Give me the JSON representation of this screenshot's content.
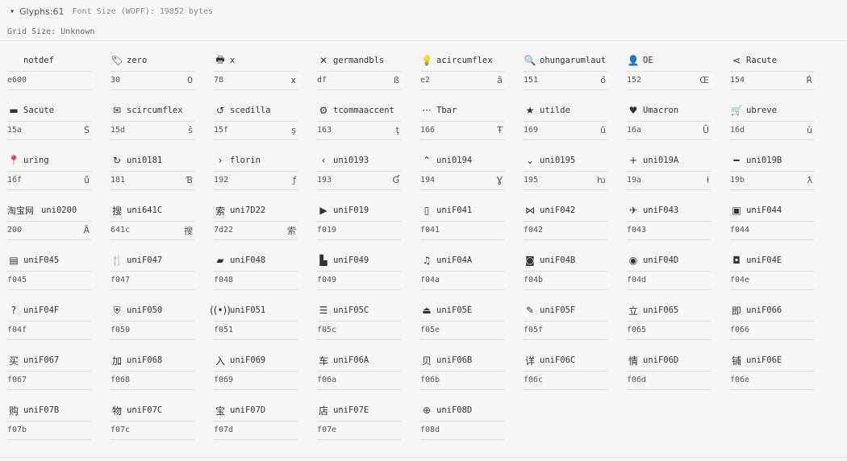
{
  "header": {
    "toggle_icon": "▾",
    "glyphs_label": "Glyphs:",
    "glyphs_count": "61",
    "font_size": "Font Size (WOFF): 19852 bytes",
    "grid_size": "Grid Size: Unknown"
  },
  "glyphs": [
    {
      "icon": "",
      "name": "notdef",
      "code": "e600",
      "glyph": "",
      "icon_name": "notdef-icon"
    },
    {
      "icon": "🏷",
      "name": "zero",
      "code": "30",
      "glyph": "0",
      "icon_name": "tag-icon"
    },
    {
      "icon": "🖶",
      "name": "x",
      "code": "78",
      "glyph": "x",
      "icon_name": "print-icon"
    },
    {
      "icon": "✕",
      "name": "germandbls",
      "code": "df",
      "glyph": "ß",
      "icon_name": "close-icon"
    },
    {
      "icon": "💡",
      "name": "acircumflex",
      "code": "e2",
      "glyph": "â",
      "icon_name": "lightbulb-icon"
    },
    {
      "icon": "🔍",
      "name": "ohungarumlaut",
      "code": "151",
      "glyph": "ő",
      "icon_name": "search-icon"
    },
    {
      "icon": "👤",
      "name": "OE",
      "code": "152",
      "glyph": "Œ",
      "icon_name": "user-icon"
    },
    {
      "icon": "⋖",
      "name": "Racute",
      "code": "154",
      "glyph": "Ŕ",
      "icon_name": "share-icon"
    },
    {
      "icon": "▬",
      "name": "Sacute",
      "code": "15a",
      "glyph": "Ś",
      "icon_name": "credit-card-icon"
    },
    {
      "icon": "✉",
      "name": "scircumflex",
      "code": "15d",
      "glyph": "ŝ",
      "icon_name": "mail-icon"
    },
    {
      "icon": "↺",
      "name": "scedilla",
      "code": "15f",
      "glyph": "ş",
      "icon_name": "undo-icon"
    },
    {
      "icon": "⚙",
      "name": "tcommaaccent",
      "code": "163",
      "glyph": "ţ",
      "icon_name": "gear-icon"
    },
    {
      "icon": "···",
      "name": "Tbar",
      "code": "166",
      "glyph": "Ŧ",
      "icon_name": "more-icon"
    },
    {
      "icon": "★",
      "name": "utilde",
      "code": "169",
      "glyph": "ũ",
      "icon_name": "star-icon"
    },
    {
      "icon": "♥",
      "name": "Umacron",
      "code": "16a",
      "glyph": "Ū",
      "icon_name": "heart-icon"
    },
    {
      "icon": "🛒",
      "name": "ubreve",
      "code": "16d",
      "glyph": "ŭ",
      "icon_name": "cart-icon"
    },
    {
      "icon": "📍",
      "name": "uring",
      "code": "16f",
      "glyph": "ů",
      "icon_name": "location-pin-icon"
    },
    {
      "icon": "↻",
      "name": "uni0181",
      "code": "181",
      "glyph": "Ɓ",
      "icon_name": "refresh-icon"
    },
    {
      "icon": "›",
      "name": "florin",
      "code": "192",
      "glyph": "ƒ",
      "icon_name": "chevron-right-icon"
    },
    {
      "icon": "‹",
      "name": "uni0193",
      "code": "193",
      "glyph": "Ɠ",
      "icon_name": "chevron-left-icon"
    },
    {
      "icon": "⌃",
      "name": "uni0194",
      "code": "194",
      "glyph": "Ɣ",
      "icon_name": "chevron-up-icon"
    },
    {
      "icon": "⌄",
      "name": "uni0195",
      "code": "195",
      "glyph": "ƕ",
      "icon_name": "chevron-down-icon"
    },
    {
      "icon": "+",
      "name": "uni019A",
      "code": "19a",
      "glyph": "ƚ",
      "icon_name": "plus-icon"
    },
    {
      "icon": "━",
      "name": "uni019B",
      "code": "19b",
      "glyph": "ƛ",
      "icon_name": "minus-icon"
    },
    {
      "icon": "淘宝网",
      "name": "uni0200",
      "code": "200",
      "glyph": "Ȁ",
      "icon_name": "taobao-logo-icon",
      "wide": true
    },
    {
      "icon": "搜",
      "name": "uni641C",
      "code": "641c",
      "glyph": "搜",
      "icon_name": "search-character-icon"
    },
    {
      "icon": "索",
      "name": "uni7D22",
      "code": "7d22",
      "glyph": "索",
      "icon_name": "suo-character-icon"
    },
    {
      "icon": "▶",
      "name": "uniF019",
      "code": "f019",
      "glyph": "",
      "icon_name": "play-icon"
    },
    {
      "icon": "▯",
      "name": "uniF041",
      "code": "f041",
      "glyph": "",
      "icon_name": "mobile-icon"
    },
    {
      "icon": "⋈",
      "name": "uniF042",
      "code": "f042",
      "glyph": "",
      "icon_name": "bowtie-icon"
    },
    {
      "icon": "✈",
      "name": "uniF043",
      "code": "f043",
      "glyph": "",
      "icon_name": "airplane-icon"
    },
    {
      "icon": "▣",
      "name": "uniF044",
      "code": "f044",
      "glyph": "",
      "icon_name": "calendar-icon"
    },
    {
      "icon": "▤",
      "name": "uniF045",
      "code": "f045",
      "glyph": "",
      "icon_name": "ticket-icon"
    },
    {
      "icon": "🍴",
      "name": "uniF047",
      "code": "f047",
      "glyph": "",
      "icon_name": "utensils-icon"
    },
    {
      "icon": "▰",
      "name": "uniF048",
      "code": "f048",
      "glyph": "",
      "icon_name": "wallet-icon"
    },
    {
      "icon": "▙",
      "name": "uniF049",
      "code": "f049",
      "glyph": "",
      "icon_name": "sofa-icon"
    },
    {
      "icon": "♫",
      "name": "uniF04A",
      "code": "f04a",
      "glyph": "",
      "icon_name": "music-icon"
    },
    {
      "icon": "◙",
      "name": "uniF04B",
      "code": "f04b",
      "glyph": "",
      "icon_name": "pot-icon"
    },
    {
      "icon": "◉",
      "name": "uniF04D",
      "code": "f04d",
      "glyph": "",
      "icon_name": "taobao-circle-icon"
    },
    {
      "icon": "◘",
      "name": "uniF04E",
      "code": "f04e",
      "glyph": "",
      "icon_name": "clock-card-icon"
    },
    {
      "icon": "?",
      "name": "uniF04F",
      "code": "f04f",
      "glyph": "",
      "icon_name": "help-icon"
    },
    {
      "icon": "⛨",
      "name": "uniF050",
      "code": "f050",
      "glyph": "",
      "icon_name": "shield-icon"
    },
    {
      "icon": "((•))",
      "name": "uniF051",
      "code": "f051",
      "glyph": "",
      "icon_name": "broadcast-icon"
    },
    {
      "icon": "☰",
      "name": "uniF05C",
      "code": "f05c",
      "glyph": "",
      "icon_name": "menu-icon"
    },
    {
      "icon": "⏏",
      "name": "uniF05E",
      "code": "f05e",
      "glyph": "",
      "icon_name": "upload-icon"
    },
    {
      "icon": "✎",
      "name": "uniF05F",
      "code": "f05f",
      "glyph": "",
      "icon_name": "pencil-icon"
    },
    {
      "icon": "立",
      "name": "uniF065",
      "code": "f065",
      "glyph": "",
      "icon_name": "li-character-icon"
    },
    {
      "icon": "即",
      "name": "uniF066",
      "code": "f066",
      "glyph": "",
      "icon_name": "ji-character-icon"
    },
    {
      "icon": "买",
      "name": "uniF067",
      "code": "f067",
      "glyph": "",
      "icon_name": "mai-character-icon"
    },
    {
      "icon": "加",
      "name": "uniF068",
      "code": "f068",
      "glyph": "",
      "icon_name": "jia-character-icon"
    },
    {
      "icon": "入",
      "name": "uniF069",
      "code": "f069",
      "glyph": "",
      "icon_name": "ru-character-icon"
    },
    {
      "icon": "车",
      "name": "uniF06A",
      "code": "f06a",
      "glyph": "",
      "icon_name": "che-character-icon"
    },
    {
      "icon": "贝",
      "name": "uniF06B",
      "code": "f06b",
      "glyph": "",
      "icon_name": "bei-character-icon"
    },
    {
      "icon": "详",
      "name": "uniF06C",
      "code": "f06c",
      "glyph": "",
      "icon_name": "xiang-character-icon"
    },
    {
      "icon": "情",
      "name": "uniF06D",
      "code": "f06d",
      "glyph": "",
      "icon_name": "qing-character-icon"
    },
    {
      "icon": "铺",
      "name": "uniF06E",
      "code": "f06e",
      "glyph": "",
      "icon_name": "pu-character-icon"
    },
    {
      "icon": "购",
      "name": "uniF07B",
      "code": "f07b",
      "glyph": "",
      "icon_name": "gou-character-icon"
    },
    {
      "icon": "物",
      "name": "uniF07C",
      "code": "f07c",
      "glyph": "",
      "icon_name": "wu-character-icon"
    },
    {
      "icon": "宝",
      "name": "uniF07D",
      "code": "f07d",
      "glyph": "",
      "icon_name": "bao-character-icon"
    },
    {
      "icon": "店",
      "name": "uniF07E",
      "code": "f07e",
      "glyph": "",
      "icon_name": "dian-character-icon"
    },
    {
      "icon": "⊕",
      "name": "uniF08D",
      "code": "f08d",
      "glyph": "",
      "icon_name": "film-reel-icon"
    }
  ]
}
